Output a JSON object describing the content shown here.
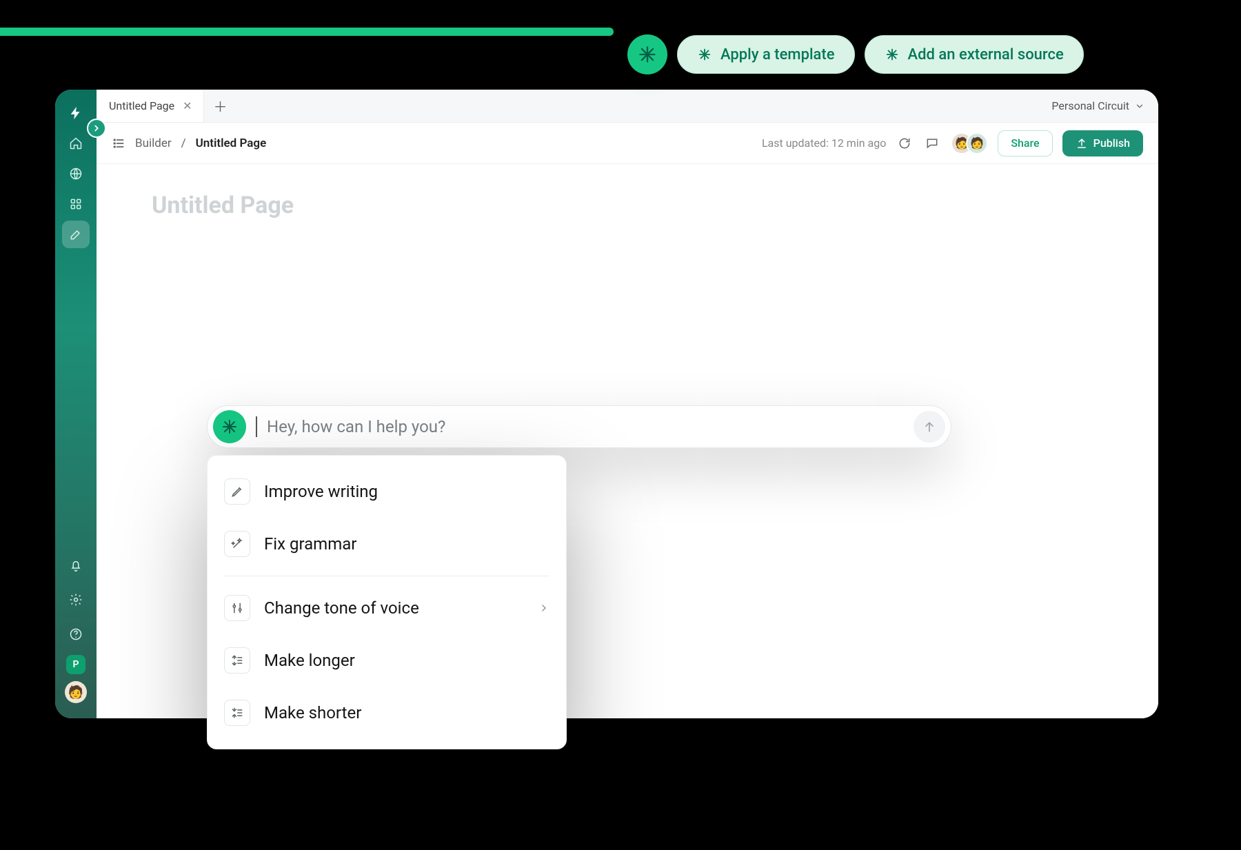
{
  "callouts": {
    "apply_template": "Apply a template",
    "external_source": "Add an external source"
  },
  "tab": {
    "title": "Untitled Page"
  },
  "workspace": {
    "label": "Personal Circuit"
  },
  "breadcrumb": {
    "root": "Builder",
    "separator": "/",
    "page": "Untitled Page"
  },
  "toolbar": {
    "status": "Last updated: 12 min ago",
    "share": "Share",
    "publish": "Publish"
  },
  "page": {
    "title_placeholder": "Untitled Page"
  },
  "ai_prompt": {
    "placeholder": "Hey, how can I help you?"
  },
  "ai_menu": {
    "items1": [
      {
        "label": "Improve writing",
        "icon": "pencil"
      },
      {
        "label": "Fix grammar",
        "icon": "wand"
      }
    ],
    "items2": [
      {
        "label": "Change tone of voice",
        "icon": "sliders",
        "submenu": true
      },
      {
        "label": "Make longer",
        "icon": "expand"
      },
      {
        "label": "Make shorter",
        "icon": "shrink"
      }
    ]
  },
  "rail": {
    "badge": "P"
  }
}
